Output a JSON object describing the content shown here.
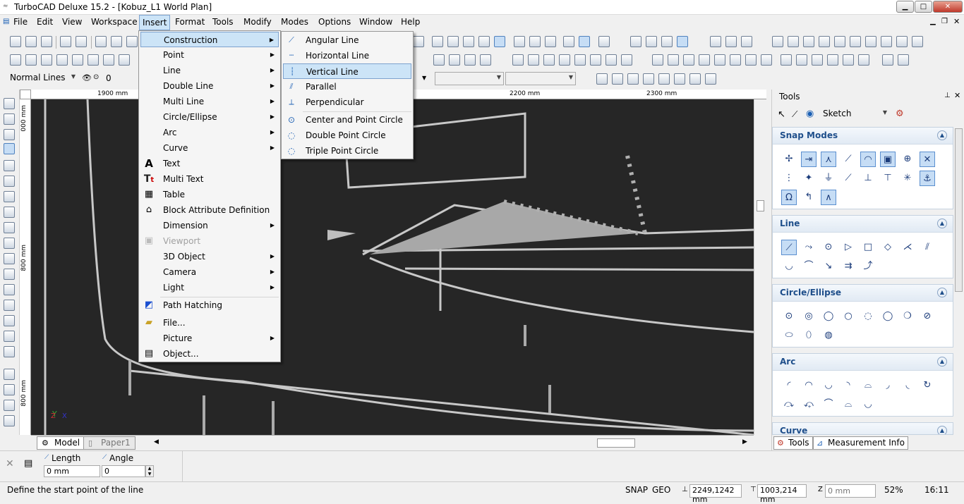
{
  "window": {
    "title": "TurboCAD Deluxe 15.2 - [Kobuz_L1 World Plan]"
  },
  "menubar": [
    "File",
    "Edit",
    "View",
    "Workspace",
    "Insert",
    "Format",
    "Tools",
    "Modify",
    "Modes",
    "Options",
    "Window",
    "Help"
  ],
  "property_bar": {
    "line_style": "Normal Lines",
    "layer_value": "0"
  },
  "ruler": {
    "top_labels": [
      "1900 mm",
      "2200 mm",
      "2300 mm"
    ],
    "left_labels": [
      "000 mm",
      "800 mm",
      "800 mm"
    ]
  },
  "insert_menu": {
    "items": [
      {
        "label": "Construction",
        "submenu": true
      },
      {
        "label": "Point",
        "submenu": true
      },
      {
        "label": "Line",
        "submenu": true
      },
      {
        "label": "Double Line",
        "submenu": true
      },
      {
        "label": "Multi Line",
        "submenu": true
      },
      {
        "label": "Circle/Ellipse",
        "submenu": true
      },
      {
        "label": "Arc",
        "submenu": true
      },
      {
        "label": "Curve",
        "submenu": true
      },
      {
        "label": "Text"
      },
      {
        "label": "Multi Text"
      },
      {
        "label": "Table"
      },
      {
        "label": "Block Attribute Definition"
      },
      {
        "label": "Dimension",
        "submenu": true
      },
      {
        "label": "Viewport",
        "disabled": true
      },
      {
        "label": "3D Object",
        "submenu": true
      },
      {
        "label": "Camera",
        "submenu": true
      },
      {
        "label": "Light",
        "submenu": true
      },
      {
        "label": "Path Hatching"
      },
      {
        "label": "File..."
      },
      {
        "label": "Picture",
        "submenu": true
      },
      {
        "label": "Object..."
      }
    ]
  },
  "construction_submenu": {
    "items": [
      "Angular Line",
      "Horizontal Line",
      "Vertical Line",
      "Parallel",
      "Perpendicular",
      "Center and Point Circle",
      "Double Point Circle",
      "Triple Point Circle"
    ],
    "highlighted": "Vertical Line"
  },
  "tools_panel": {
    "title": "Tools",
    "mode": "Sketch",
    "groups": [
      "Snap Modes",
      "Line",
      "Circle/Ellipse",
      "Arc",
      "Curve"
    ],
    "bottom_tabs": [
      "Tools",
      "Measurement Info"
    ]
  },
  "tabs": {
    "model": "Model",
    "paper": "Paper1"
  },
  "inspector": {
    "length_label": "Length",
    "length_value": "0 mm",
    "angle_label": "Angle",
    "angle_value": "0"
  },
  "status": {
    "message": "Define the start point of the line",
    "snap": "SNAP",
    "geo": "GEO",
    "x": "2249,1242 mm",
    "y": "1003,214 mm",
    "z_placeholder": "0 mm",
    "zoom": "52%",
    "time": "16:11"
  },
  "colors": {
    "menu_highlight": "#cce4f7",
    "canvas_bg": "#262626",
    "panel_header": "#1f4f8b"
  }
}
